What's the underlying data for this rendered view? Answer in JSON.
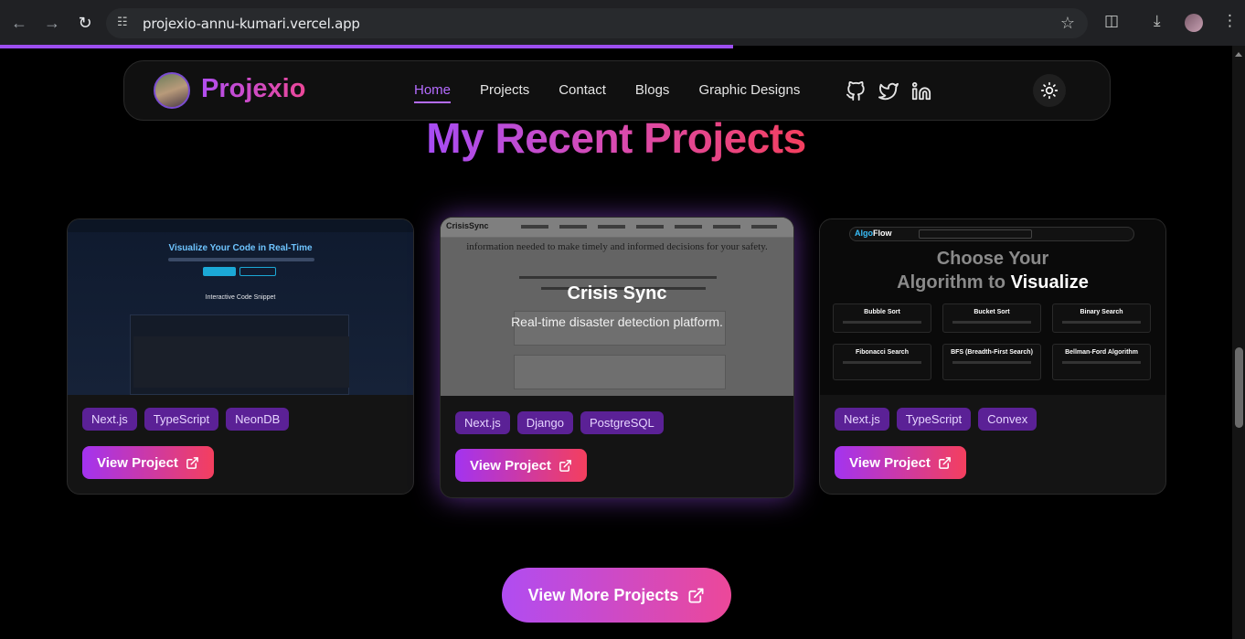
{
  "browser": {
    "url": "projexio-annu-kumari.vercel.app",
    "back_icon": "arrow-left-icon",
    "forward_icon": "arrow-right-icon",
    "reload_icon": "reload-icon"
  },
  "nav": {
    "brand": "Projexio",
    "links": [
      "Home",
      "Projects",
      "Contact",
      "Blogs",
      "Graphic Designs"
    ],
    "active": "Home",
    "socials": [
      "github-icon",
      "twitter-icon",
      "linkedin-icon"
    ],
    "theme_icon": "sun-icon"
  },
  "section": {
    "title": "My Recent Projects"
  },
  "projects": [
    {
      "preview": {
        "heading": "Visualize Your Code in Real-Time",
        "subheading": "Interactive Code Snippet"
      },
      "tags": [
        "Next.js",
        "TypeScript",
        "NeonDB"
      ],
      "button": "View Project"
    },
    {
      "preview": {
        "brand": "CrisisSync",
        "text": "information needed to make timely and informed decisions for your safety."
      },
      "title": "Crisis Sync",
      "description": "Real-time disaster detection platform.",
      "tags": [
        "Next.js",
        "Django",
        "PostgreSQL"
      ],
      "button": "View Project"
    },
    {
      "preview": {
        "brand_a": "Algo",
        "brand_b": "Flow",
        "heading_line1": "Choose Your",
        "heading_a": "Algorithm",
        "heading_to": " to ",
        "heading_b": "Visualize",
        "algorithms": [
          "Bubble Sort",
          "Bucket Sort",
          "Binary Search",
          "Fibonacci Search",
          "BFS (Breadth-First Search)",
          "Bellman-Ford Algorithm"
        ]
      },
      "tags": [
        "Next.js",
        "TypeScript",
        "Convex"
      ],
      "button": "View Project"
    }
  ],
  "more_button": "View More Projects",
  "colors": {
    "accent_purple": "#a64cf5",
    "accent_pink": "#ec4899",
    "tag_bg": "#5b2196"
  }
}
